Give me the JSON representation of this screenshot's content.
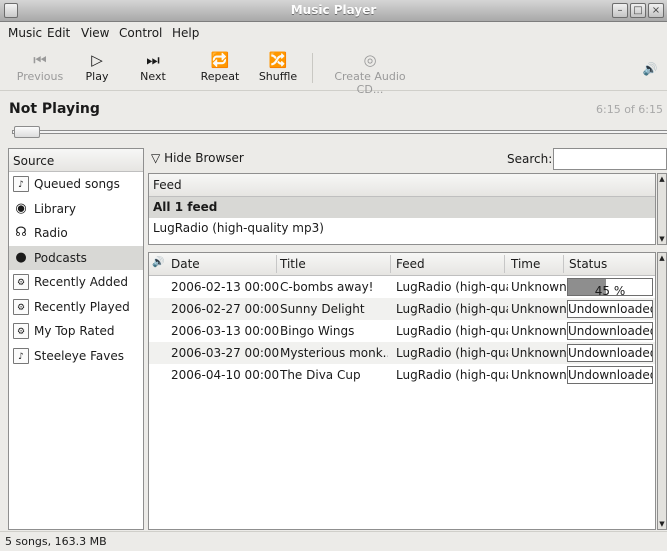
{
  "window": {
    "title": "Music Player"
  },
  "menu": [
    "Music",
    "Edit",
    "View",
    "Control",
    "Help"
  ],
  "toolbar": {
    "previous": "Previous",
    "play": "Play",
    "next": "Next",
    "repeat": "Repeat",
    "shuffle": "Shuffle",
    "create_cd": "Create Audio CD..."
  },
  "now_playing": {
    "title": "Not Playing",
    "time": "6:15 of 6:15"
  },
  "source": {
    "header": "Source",
    "items": [
      {
        "label": "Queued songs",
        "icon": "queue-icon"
      },
      {
        "label": "Library",
        "icon": "library-icon"
      },
      {
        "label": "Radio",
        "icon": "radio-icon"
      },
      {
        "label": "Podcasts",
        "icon": "podcast-icon"
      },
      {
        "label": "Recently Added",
        "icon": "smart-playlist-icon"
      },
      {
        "label": "Recently Played",
        "icon": "smart-playlist-icon"
      },
      {
        "label": "My Top Rated",
        "icon": "smart-playlist-icon"
      },
      {
        "label": "Steeleye Faves",
        "icon": "playlist-icon"
      }
    ],
    "selected": "Podcasts"
  },
  "browser": {
    "hide_label": "Hide Browser",
    "search_label": "Search:",
    "search_value": ""
  },
  "feeds": {
    "header": "Feed",
    "rows": [
      "All 1 feed",
      "LugRadio (high-quality mp3)"
    ]
  },
  "episodes": {
    "columns": {
      "date": "Date",
      "title": "Title",
      "feed": "Feed",
      "time": "Time",
      "status": "Status"
    },
    "rows": [
      {
        "date": "2006-02-13 00:00",
        "title": "C-bombs away!",
        "feed": "LugRadio (high-quali",
        "time": "Unknown",
        "status": "45 %",
        "progress": 45
      },
      {
        "date": "2006-02-27 00:00",
        "title": "Sunny Delight",
        "feed": "LugRadio (high-quali",
        "time": "Unknown",
        "status": "Undownloaded"
      },
      {
        "date": "2006-03-13 00:00",
        "title": "Bingo Wings",
        "feed": "LugRadio (high-quali",
        "time": "Unknown",
        "status": "Undownloaded"
      },
      {
        "date": "2006-03-27 00:00",
        "title": "Mysterious monk...",
        "feed": "LugRadio (high-quali",
        "time": "Unknown",
        "status": "Undownloaded"
      },
      {
        "date": "2006-04-10 00:00",
        "title": "The Diva Cup",
        "feed": "LugRadio (high-quali",
        "time": "Unknown",
        "status": "Undownloaded"
      }
    ]
  },
  "status_bar": {
    "text": "5 songs, 163.3 MB"
  }
}
